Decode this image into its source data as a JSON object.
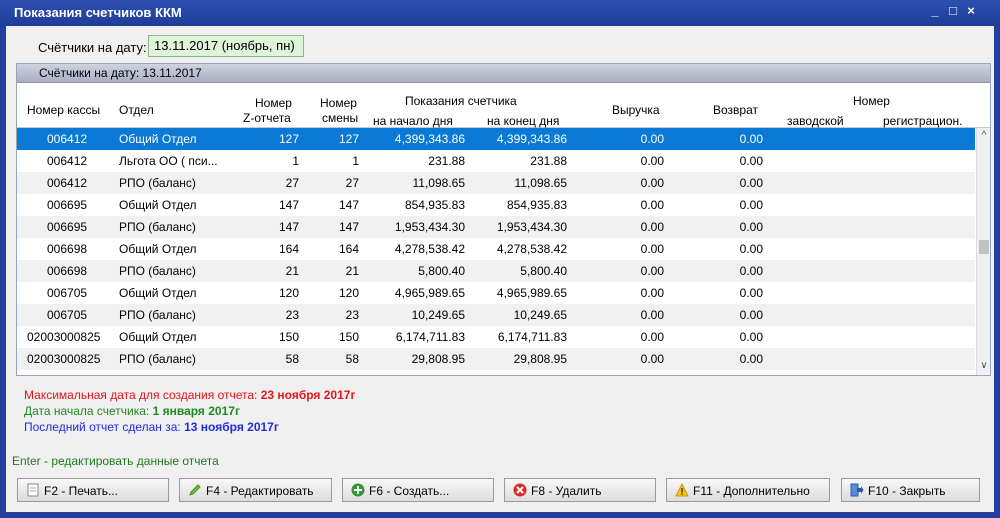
{
  "window": {
    "title": "Показания счетчиков ККМ",
    "min": "_",
    "max": "□",
    "close": "×"
  },
  "date_filter": {
    "label": "Счётчики на дату:",
    "value": "13.11.2017  (ноябрь, пн)"
  },
  "grid": {
    "group_header": "Счётчики на дату: 13.11.2017",
    "headers": {
      "kassa": "Номер кассы",
      "otdel": "Отдел",
      "z_line1": "Номер",
      "z_line2": "Z-отчета",
      "smena_line1": "Номер",
      "smena_line2": "смены",
      "pokaz": "Показания счетчика",
      "start": "на начало дня",
      "end": "на конец дня",
      "vyruchka": "Выручка",
      "vozvrat": "Возврат",
      "nomer": "Номер",
      "zavod": "заводской",
      "reg": "регистрацион."
    },
    "rows": [
      {
        "kassa": "006412",
        "otdel": "Общий Отдел",
        "z": "127",
        "smena": "127",
        "start": "4,399,343.86",
        "end": "4,399,343.86",
        "vyr": "0.00",
        "voz": "0.00"
      },
      {
        "kassa": "006412",
        "otdel": " Льгота ОО ( пси...",
        "z": "1",
        "smena": "1",
        "start": "231.88",
        "end": "231.88",
        "vyr": "0.00",
        "voz": "0.00"
      },
      {
        "kassa": "006412",
        "otdel": "РПО (баланс)",
        "z": "27",
        "smena": "27",
        "start": "11,098.65",
        "end": "11,098.65",
        "vyr": "0.00",
        "voz": "0.00"
      },
      {
        "kassa": "006695",
        "otdel": "Общий Отдел",
        "z": "147",
        "smena": "147",
        "start": "854,935.83",
        "end": "854,935.83",
        "vyr": "0.00",
        "voz": "0.00"
      },
      {
        "kassa": "006695",
        "otdel": "РПО (баланс)",
        "z": "147",
        "smena": "147",
        "start": "1,953,434.30",
        "end": "1,953,434.30",
        "vyr": "0.00",
        "voz": "0.00"
      },
      {
        "kassa": "006698",
        "otdel": "Общий Отдел",
        "z": "164",
        "smena": "164",
        "start": "4,278,538.42",
        "end": "4,278,538.42",
        "vyr": "0.00",
        "voz": "0.00"
      },
      {
        "kassa": "006698",
        "otdel": "РПО (баланс)",
        "z": "21",
        "smena": "21",
        "start": "5,800.40",
        "end": "5,800.40",
        "vyr": "0.00",
        "voz": "0.00"
      },
      {
        "kassa": "006705",
        "otdel": "Общий Отдел",
        "z": "120",
        "smena": "120",
        "start": "4,965,989.65",
        "end": "4,965,989.65",
        "vyr": "0.00",
        "voz": "0.00"
      },
      {
        "kassa": "006705",
        "otdel": "РПО (баланс)",
        "z": "23",
        "smena": "23",
        "start": "10,249.65",
        "end": "10,249.65",
        "vyr": "0.00",
        "voz": "0.00"
      },
      {
        "kassa": "02003000825",
        "otdel": "Общий Отдел",
        "z": "150",
        "smena": "150",
        "start": "6,174,711.83",
        "end": "6,174,711.83",
        "vyr": "0.00",
        "voz": "0.00"
      },
      {
        "kassa": "02003000825",
        "otdel": "РПО (баланс)",
        "z": "58",
        "smena": "58",
        "start": "29,808.95",
        "end": "29,808.95",
        "vyr": "0.00",
        "voz": "0.00"
      }
    ]
  },
  "info": {
    "max_date_label": "Максимальная дата для создания отчета:",
    "max_date_value": "23 ноября 2017г",
    "start_date_label": "Дата начала счетчика:",
    "start_date_value": "1 января 2017г",
    "last_report_label": "Последний отчет сделан за:",
    "last_report_value": "13 ноября 2017г",
    "colors": {
      "red": "#e8141b",
      "green": "#1f8a1f",
      "blue": "#1e2be0"
    }
  },
  "hint": "Enter - редактировать данные отчета",
  "buttons": {
    "print": "F2 - Печать...",
    "edit": "F4 - Редактировать",
    "create": "F6 - Создать...",
    "delete": "F8 - Удалить",
    "more": "F11 - Дополнительно",
    "close": "F10 - Закрыть"
  }
}
